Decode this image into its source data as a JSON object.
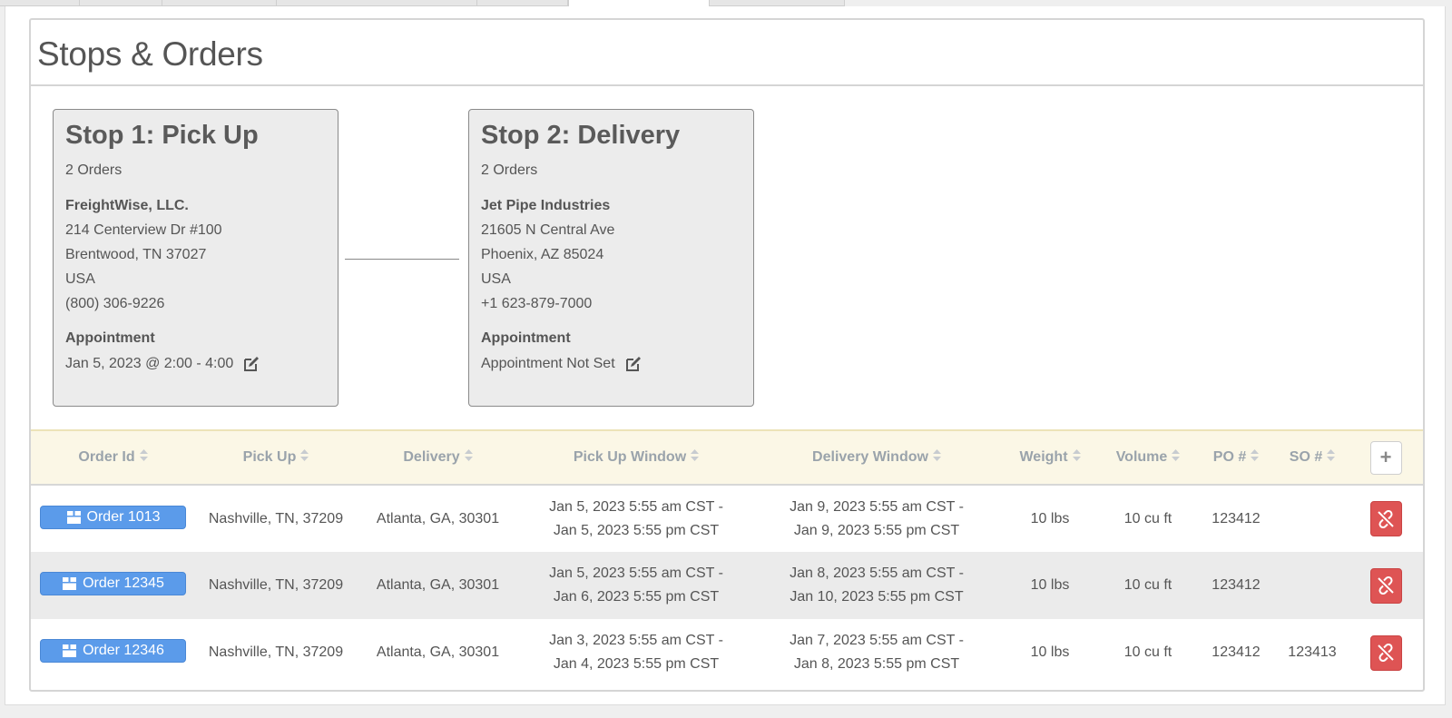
{
  "panel": {
    "title": "Stops & Orders"
  },
  "stops": [
    {
      "title": "Stop 1: Pick Up",
      "orders_count": "2 Orders",
      "company": "FreightWise, LLC.",
      "address1": "214 Centerview Dr #100",
      "address2": "Brentwood, TN 37027",
      "country": "USA",
      "phone": "(800) 306-9226",
      "appointment_label": "Appointment",
      "appointment_value": "Jan 5, 2023 @ 2:00 - 4:00"
    },
    {
      "title": "Stop 2: Delivery",
      "orders_count": "2 Orders",
      "company": "Jet Pipe Industries",
      "address1": "21605 N Central Ave",
      "address2": "Phoenix, AZ 85024",
      "country": "USA",
      "phone": "+1 623-879-7000",
      "appointment_label": "Appointment",
      "appointment_value": "Appointment Not Set"
    }
  ],
  "table": {
    "headers": {
      "order_id": "Order Id",
      "pick_up": "Pick Up",
      "delivery": "Delivery",
      "pick_up_window": "Pick Up Window",
      "delivery_window": "Delivery Window",
      "weight": "Weight",
      "volume": "Volume",
      "po": "PO #",
      "so": "SO #",
      "add": "+"
    },
    "rows": [
      {
        "order": "Order 1013",
        "pick_up": "Nashville, TN, 37209",
        "delivery": "Atlanta, GA, 30301",
        "pu_window_1": "Jan 5, 2023 5:55 am CST -",
        "pu_window_2": "Jan 5, 2023 5:55 pm CST",
        "del_window_1": "Jan 9, 2023 5:55 am CST -",
        "del_window_2": "Jan 9, 2023 5:55 pm CST",
        "weight": "10 lbs",
        "volume": "10 cu ft",
        "po": "123412",
        "so": ""
      },
      {
        "order": "Order 12345",
        "pick_up": "Nashville, TN, 37209",
        "delivery": "Atlanta, GA, 30301",
        "pu_window_1": "Jan 5, 2023 5:55 am CST -",
        "pu_window_2": "Jan 6, 2023 5:55 pm CST",
        "del_window_1": "Jan 8, 2023 5:55 am CST -",
        "del_window_2": "Jan 10, 2023 5:55 pm CST",
        "weight": "10 lbs",
        "volume": "10 cu ft",
        "po": "123412",
        "so": ""
      },
      {
        "order": "Order 12346",
        "pick_up": "Nashville, TN, 37209",
        "delivery": "Atlanta, GA, 30301",
        "pu_window_1": "Jan 3, 2023 5:55 am CST -",
        "pu_window_2": "Jan 4, 2023 5:55 pm CST",
        "del_window_1": "Jan 7, 2023 5:55 am CST -",
        "del_window_2": "Jan 8, 2023 5:55 pm CST",
        "weight": "10 lbs",
        "volume": "10 cu ft",
        "po": "123412",
        "so": "123413"
      }
    ]
  },
  "colors": {
    "order_button": "#5b9bea",
    "delete_button": "#de5454",
    "table_header_bg": "#fbf7e6",
    "stop_card_bg": "#ececec"
  },
  "icons": {
    "order_button": "box-icon",
    "delete_button": "unlink-icon",
    "appointment_edit": "edit-icon",
    "sort": "sort-icon"
  }
}
